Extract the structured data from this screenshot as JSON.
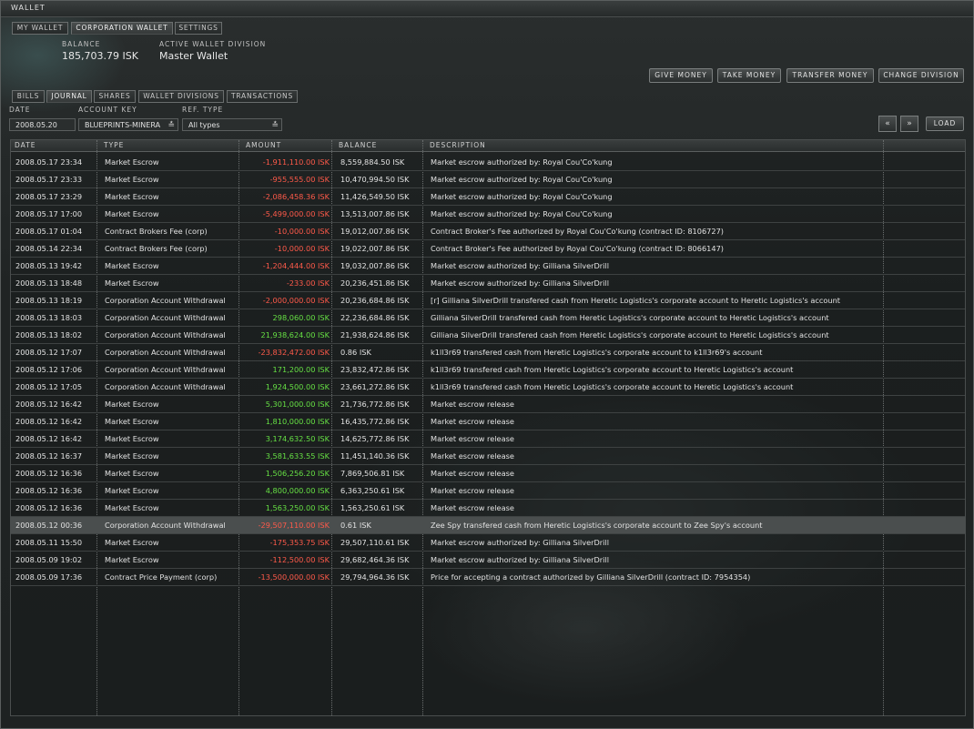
{
  "window": {
    "title": "WALLET"
  },
  "top_tabs": [
    "MY WALLET",
    "CORPORATION WALLET",
    "SETTINGS"
  ],
  "balance": {
    "label": "BALANCE",
    "value": "185,703.79 ISK"
  },
  "division": {
    "label": "ACTIVE WALLET DIVISION",
    "value": "Master Wallet"
  },
  "actions": [
    "GIVE MONEY",
    "TAKE MONEY",
    "TRANSFER MONEY",
    "CHANGE DIVISION"
  ],
  "sub_tabs": [
    "BILLS",
    "JOURNAL",
    "SHARES",
    "WALLET DIVISIONS",
    "TRANSACTIONS"
  ],
  "filters": {
    "date_label": "DATE",
    "date_value": "2008.05.20",
    "account_label": "ACCOUNT KEY",
    "account_value": "BLUEPRINTS-MINERA",
    "ref_label": "REF. TYPE",
    "ref_value": "All types",
    "load_label": "LOAD"
  },
  "icons": {
    "prev": "rewind-icon",
    "next": "fast-forward-icon",
    "dropdown": "chevron-down-icon"
  },
  "colors": {
    "negative": "#ff5a4a",
    "positive": "#66e044",
    "selected_row": "#4a4e4e"
  },
  "columns": [
    "DATE",
    "TYPE",
    "AMOUNT",
    "BALANCE",
    "DESCRIPTION"
  ],
  "rows": [
    {
      "date": "2008.05.17 23:34",
      "type": "Market Escrow",
      "amount": "-1,911,110.00 ISK",
      "sign": "neg",
      "balance": "8,559,884.50 ISK",
      "description": "Market escrow authorized by: Royal Cou'Co'kung"
    },
    {
      "date": "2008.05.17 23:33",
      "type": "Market Escrow",
      "amount": "-955,555.00 ISK",
      "sign": "neg",
      "balance": "10,470,994.50 ISK",
      "description": "Market escrow authorized by: Royal Cou'Co'kung"
    },
    {
      "date": "2008.05.17 23:29",
      "type": "Market Escrow",
      "amount": "-2,086,458.36 ISK",
      "sign": "neg",
      "balance": "11,426,549.50 ISK",
      "description": "Market escrow authorized by: Royal Cou'Co'kung"
    },
    {
      "date": "2008.05.17 17:00",
      "type": "Market Escrow",
      "amount": "-5,499,000.00 ISK",
      "sign": "neg",
      "balance": "13,513,007.86 ISK",
      "description": "Market escrow authorized by: Royal Cou'Co'kung"
    },
    {
      "date": "2008.05.17 01:04",
      "type": "Contract Brokers Fee (corp)",
      "amount": "-10,000.00 ISK",
      "sign": "neg",
      "balance": "19,012,007.86 ISK",
      "description": "Contract Broker's Fee authorized by Royal Cou'Co'kung (contract ID: 8106727)"
    },
    {
      "date": "2008.05.14 22:34",
      "type": "Contract Brokers Fee (corp)",
      "amount": "-10,000.00 ISK",
      "sign": "neg",
      "balance": "19,022,007.86 ISK",
      "description": "Contract Broker's Fee authorized by Royal Cou'Co'kung (contract ID: 8066147)"
    },
    {
      "date": "2008.05.13 19:42",
      "type": "Market Escrow",
      "amount": "-1,204,444.00 ISK",
      "sign": "neg",
      "balance": "19,032,007.86 ISK",
      "description": "Market escrow authorized by: Gilliana SilverDrill"
    },
    {
      "date": "2008.05.13 18:48",
      "type": "Market Escrow",
      "amount": "-233.00 ISK",
      "sign": "neg",
      "balance": "20,236,451.86 ISK",
      "description": "Market escrow authorized by: Gilliana SilverDrill"
    },
    {
      "date": "2008.05.13 18:19",
      "type": "Corporation Account Withdrawal",
      "amount": "-2,000,000.00 ISK",
      "sign": "neg",
      "balance": "20,236,684.86 ISK",
      "description": "[r] Gilliana SilverDrill transfered cash from Heretic Logistics's corporate account to Heretic Logistics's account"
    },
    {
      "date": "2008.05.13 18:03",
      "type": "Corporation Account Withdrawal",
      "amount": "298,060.00 ISK",
      "sign": "pos",
      "balance": "22,236,684.86 ISK",
      "description": "Gilliana SilverDrill transfered cash from Heretic Logistics's corporate account to Heretic Logistics's account"
    },
    {
      "date": "2008.05.13 18:02",
      "type": "Corporation Account Withdrawal",
      "amount": "21,938,624.00 ISK",
      "sign": "pos",
      "balance": "21,938,624.86 ISK",
      "description": "Gilliana SilverDrill transfered cash from Heretic Logistics's corporate account to Heretic Logistics's account"
    },
    {
      "date": "2008.05.12 17:07",
      "type": "Corporation Account Withdrawal",
      "amount": "-23,832,472.00 ISK",
      "sign": "neg",
      "balance": "0.86 ISK",
      "description": "k1ll3r69 transfered cash from Heretic Logistics's corporate account to k1ll3r69's account"
    },
    {
      "date": "2008.05.12 17:06",
      "type": "Corporation Account Withdrawal",
      "amount": "171,200.00 ISK",
      "sign": "pos",
      "balance": "23,832,472.86 ISK",
      "description": "k1ll3r69 transfered cash from Heretic Logistics's corporate account to Heretic Logistics's account"
    },
    {
      "date": "2008.05.12 17:05",
      "type": "Corporation Account Withdrawal",
      "amount": "1,924,500.00 ISK",
      "sign": "pos",
      "balance": "23,661,272.86 ISK",
      "description": "k1ll3r69 transfered cash from Heretic Logistics's corporate account to Heretic Logistics's account"
    },
    {
      "date": "2008.05.12 16:42",
      "type": "Market Escrow",
      "amount": "5,301,000.00 ISK",
      "sign": "pos",
      "balance": "21,736,772.86 ISK",
      "description": "Market escrow release"
    },
    {
      "date": "2008.05.12 16:42",
      "type": "Market Escrow",
      "amount": "1,810,000.00 ISK",
      "sign": "pos",
      "balance": "16,435,772.86 ISK",
      "description": "Market escrow release"
    },
    {
      "date": "2008.05.12 16:42",
      "type": "Market Escrow",
      "amount": "3,174,632.50 ISK",
      "sign": "pos",
      "balance": "14,625,772.86 ISK",
      "description": "Market escrow release"
    },
    {
      "date": "2008.05.12 16:37",
      "type": "Market Escrow",
      "amount": "3,581,633.55 ISK",
      "sign": "pos",
      "balance": "11,451,140.36 ISK",
      "description": "Market escrow release"
    },
    {
      "date": "2008.05.12 16:36",
      "type": "Market Escrow",
      "amount": "1,506,256.20 ISK",
      "sign": "pos",
      "balance": "7,869,506.81 ISK",
      "description": "Market escrow release"
    },
    {
      "date": "2008.05.12 16:36",
      "type": "Market Escrow",
      "amount": "4,800,000.00 ISK",
      "sign": "pos",
      "balance": "6,363,250.61 ISK",
      "description": "Market escrow release"
    },
    {
      "date": "2008.05.12 16:36",
      "type": "Market Escrow",
      "amount": "1,563,250.00 ISK",
      "sign": "pos",
      "balance": "1,563,250.61 ISK",
      "description": "Market escrow release"
    },
    {
      "date": "2008.05.12 00:36",
      "type": "Corporation Account Withdrawal",
      "amount": "-29,507,110.00 ISK",
      "sign": "neg",
      "balance": "0.61 ISK",
      "description": "Zee Spy transfered cash from Heretic Logistics's corporate account to Zee Spy's account",
      "selected": true
    },
    {
      "date": "2008.05.11 15:50",
      "type": "Market Escrow",
      "amount": "-175,353.75 ISK",
      "sign": "neg",
      "balance": "29,507,110.61 ISK",
      "description": "Market escrow authorized by: Gilliana SilverDrill"
    },
    {
      "date": "2008.05.09 19:02",
      "type": "Market Escrow",
      "amount": "-112,500.00 ISK",
      "sign": "neg",
      "balance": "29,682,464.36 ISK",
      "description": "Market escrow authorized by: Gilliana SilverDrill"
    },
    {
      "date": "2008.05.09 17:36",
      "type": "Contract Price Payment (corp)",
      "amount": "-13,500,000.00 ISK",
      "sign": "neg",
      "balance": "29,794,964.36 ISK",
      "description": "Price for accepting a contract authorized by Gilliana SilverDrill (contract ID: 7954354)"
    }
  ]
}
